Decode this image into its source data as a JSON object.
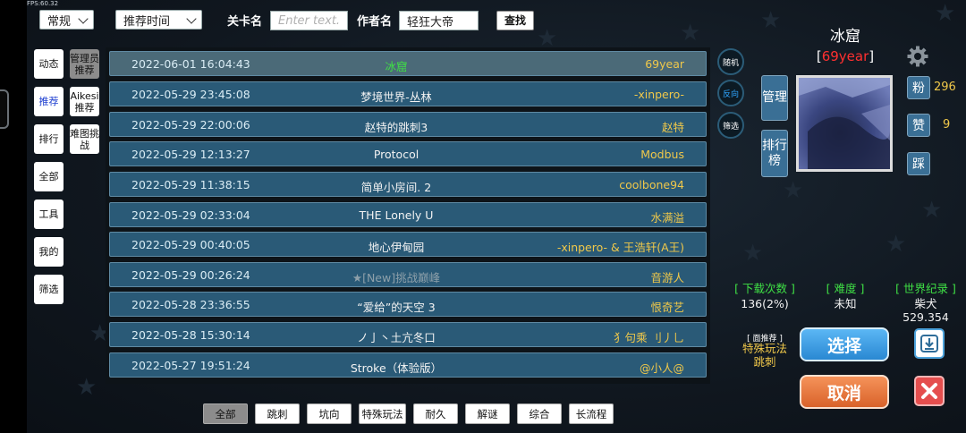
{
  "fps": "FPS:60.32",
  "top_bar": {
    "mode_select": "常规",
    "sort_select": "推荐时间",
    "level_name_label": "关卡名",
    "level_name_placeholder": "Enter text...",
    "author_label": "作者名",
    "author_value": "轻狂大帝",
    "search_label": "查找"
  },
  "left_nav": [
    "动态",
    "推荐",
    "排行",
    "全部",
    "工具",
    "我的",
    "筛选"
  ],
  "sub_nav": [
    "管理员推荐",
    "Aikesi推荐",
    "难图挑战"
  ],
  "levels": [
    {
      "date": "2022-06-01 16:04:43",
      "name": "冰窟",
      "author": "69year"
    },
    {
      "date": "2022-05-29 23:45:08",
      "name": "梦境世界-丛林",
      "author": "-xinpero-"
    },
    {
      "date": "2022-05-29 22:00:06",
      "name": "赵特的跳刺3",
      "author": "赵特"
    },
    {
      "date": "2022-05-29 12:13:27",
      "name": "Protocol",
      "author": "Modbus"
    },
    {
      "date": "2022-05-29 11:38:15",
      "name": "简单小房间. 2",
      "author": "coolbone94"
    },
    {
      "date": "2022-05-29 02:33:04",
      "name": "THE Lonely U",
      "author": "水满溢"
    },
    {
      "date": "2022-05-29 00:40:05",
      "name": "地心伊甸园",
      "author": "-xinpero- & 王浩轩(A王)"
    },
    {
      "date": "2022-05-29 00:26:24",
      "name": "★[New]挑战巅峰",
      "author": "音游人"
    },
    {
      "date": "2022-05-28 23:36:55",
      "name": "“爱给”的天空 3",
      "author": "恨奇艺"
    },
    {
      "date": "2022-05-28 15:30:14",
      "name": "ノ亅丶土亢冬口",
      "author": "犭句乘 刂丿乚"
    },
    {
      "date": "2022-05-27 19:51:24",
      "name": "Stroke（体验版）",
      "author": "@小人@"
    }
  ],
  "side_buttons": [
    "随机",
    "反向",
    "筛选"
  ],
  "detail": {
    "title": "冰窟",
    "bracket_open": "[",
    "author": "69year",
    "bracket_close": "]",
    "manage_label": "管理",
    "rank_label": "排行榜",
    "fans_label": "粉",
    "fans_count": "296",
    "likes_label": "赞",
    "likes_count": "9",
    "dislike_label": "踩",
    "downloads_header": "[ 下载次数 ]",
    "downloads_value": "136(2%)",
    "difficulty_header": "[ 难度 ]",
    "difficulty_value": "未知",
    "record_header": "[ 世界纪录 ]",
    "record_holder": "柴犬",
    "record_time": "529.354",
    "recommend_tag": "[ 面推荐 ]",
    "tags_line1": "特殊玩法",
    "tags_line2": "跳刺",
    "select_label": "选择",
    "cancel_label": "取消"
  },
  "categories": [
    "全部",
    "跳刺",
    "坑向",
    "特殊玩法",
    "耐久",
    "解谜",
    "综合",
    "长流程"
  ],
  "colors": {
    "row_bg": "#2a5a77",
    "author_yellow": "#f0c84a",
    "selected_green": "#3fe045",
    "author_red": "#ff3030"
  }
}
